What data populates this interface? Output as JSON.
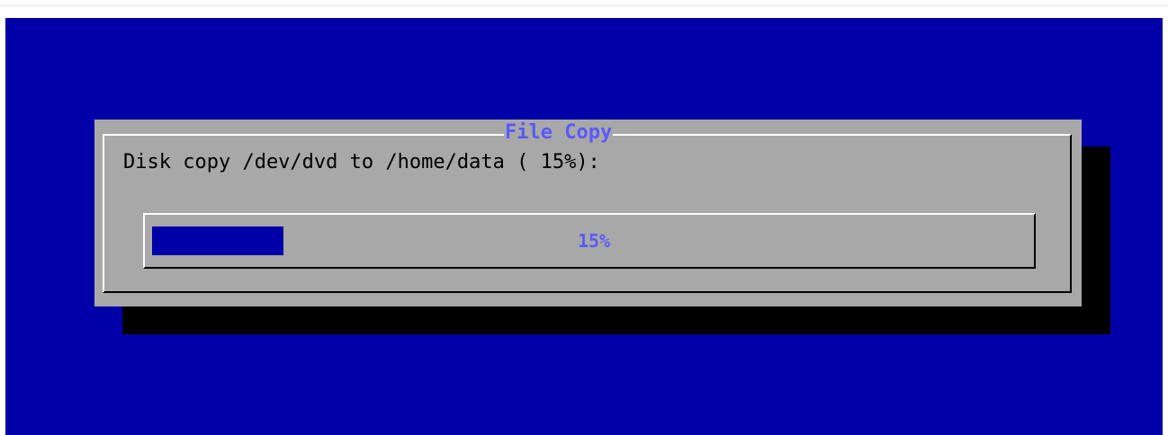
{
  "colors": {
    "screen_background": "#0000a8",
    "dialog_background": "#a8a8a8",
    "title_color": "#5a5aff",
    "gauge_fill": "#0000a8",
    "shadow": "#000000"
  },
  "dialog": {
    "title": "File Copy",
    "message": "Disk copy /dev/dvd to /home/data ( 15%):"
  },
  "gauge": {
    "percent": 15,
    "label": "15%"
  }
}
